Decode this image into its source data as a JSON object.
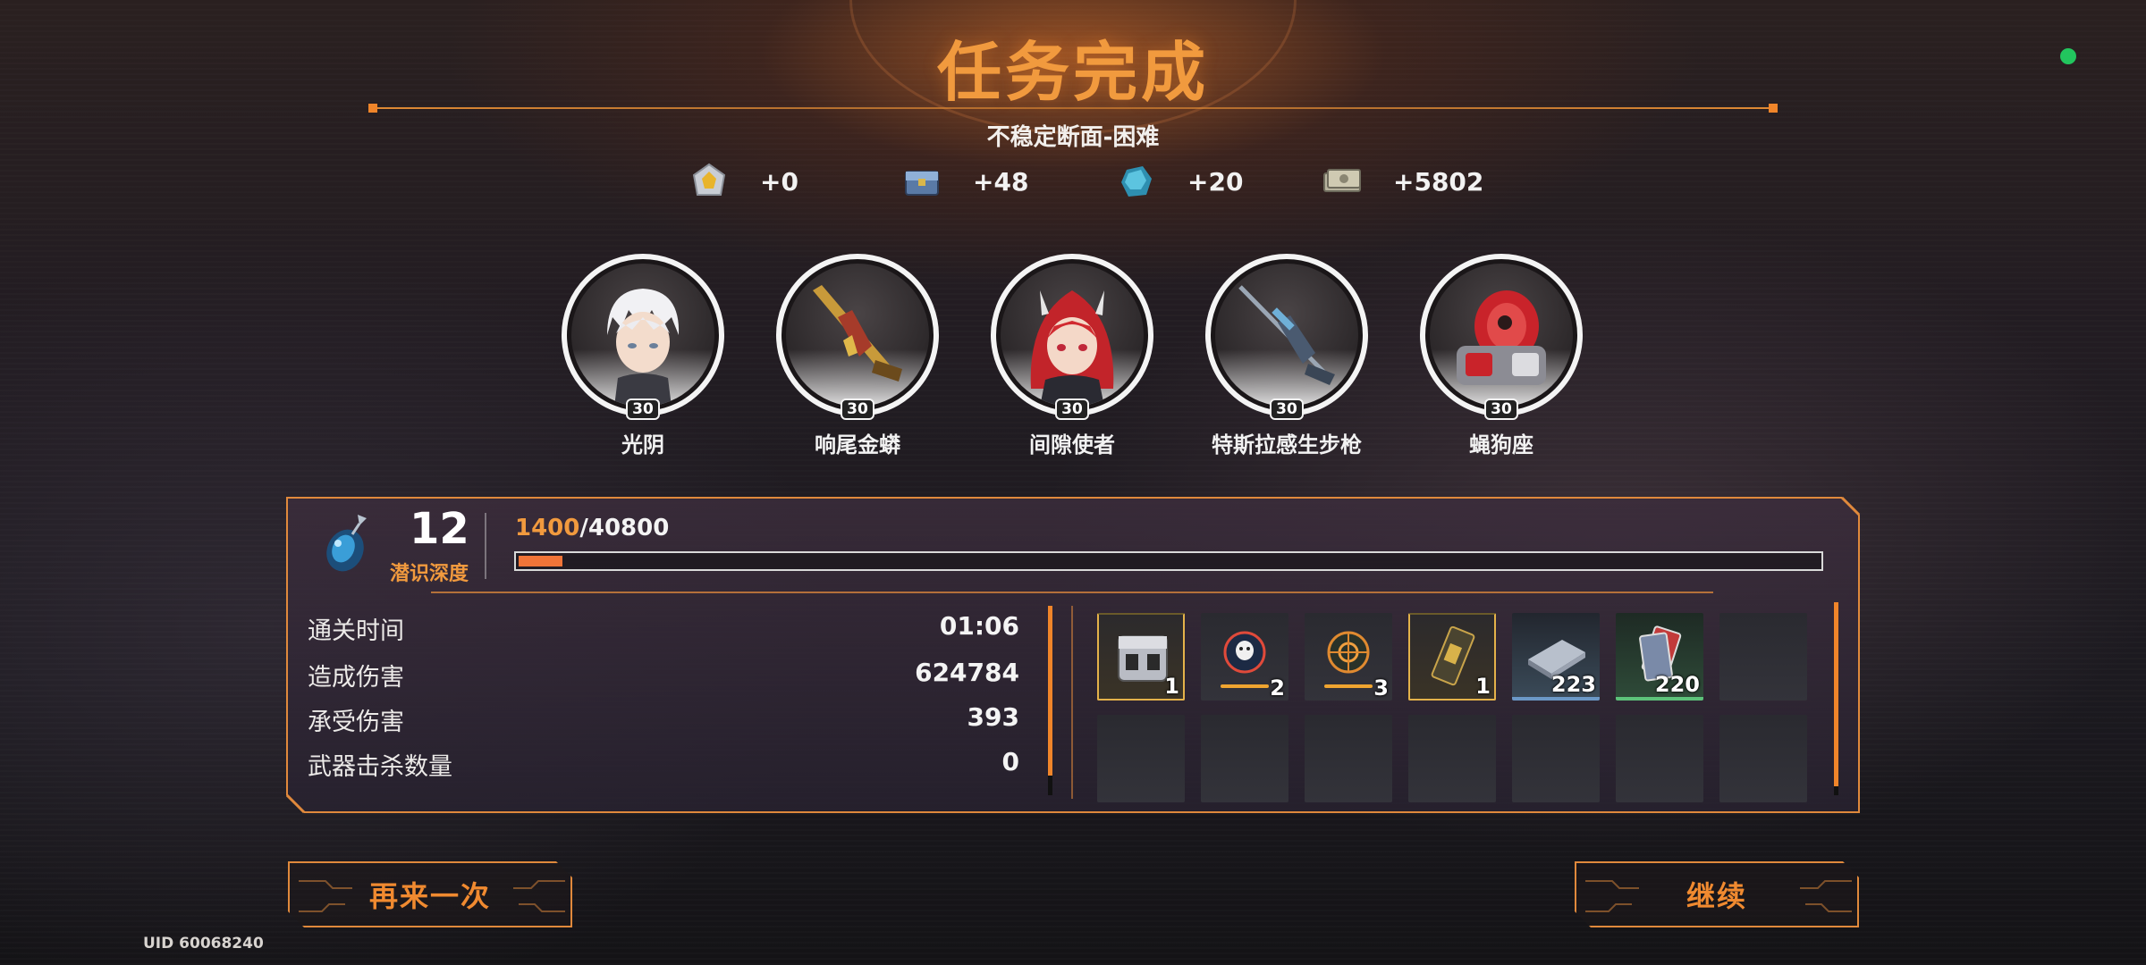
{
  "header": {
    "title": "任务完成",
    "subtitle": "不稳定断面-困难"
  },
  "rewards": [
    {
      "icon": "yellow-crystal-icon",
      "value": "+0"
    },
    {
      "icon": "blue-chest-icon",
      "value": "+48"
    },
    {
      "icon": "blue-ore-icon",
      "value": "+20"
    },
    {
      "icon": "banknote-icon",
      "value": "+5802"
    }
  ],
  "characters": [
    {
      "name": "光阴",
      "level": "30",
      "icon": "white-hair-character-avatar"
    },
    {
      "name": "响尾金蟒",
      "level": "30",
      "icon": "golden-rifle-icon"
    },
    {
      "name": "间隙使者",
      "level": "30",
      "icon": "red-hair-character-avatar"
    },
    {
      "name": "特斯拉感生步枪",
      "level": "30",
      "icon": "sniper-rifle-icon"
    },
    {
      "name": "蝇狗座",
      "level": "30",
      "icon": "red-mech-companion-icon"
    }
  ],
  "depth": {
    "level": "12",
    "label": "潜识深度",
    "exp_current": "1400",
    "exp_sep": "/",
    "exp_max": "40800",
    "progress": 0.034,
    "icon": "crystal-pendant-icon"
  },
  "stats": [
    {
      "label": "通关时间",
      "value": "01:06"
    },
    {
      "label": "造成伤害",
      "value": "624784"
    },
    {
      "label": "承受伤害",
      "value": "393"
    },
    {
      "label": "武器击杀数量",
      "value": "0"
    }
  ],
  "loot": [
    {
      "icon": "supply-crate-icon",
      "qty": "1",
      "rarity": "gold"
    },
    {
      "icon": "mask-badge-icon",
      "qty": "2",
      "rarity": "plain"
    },
    {
      "icon": "target-badge-icon",
      "qty": "3",
      "rarity": "plain"
    },
    {
      "icon": "ammo-card-icon",
      "qty": "1",
      "rarity": "gold"
    },
    {
      "icon": "metal-plate-icon",
      "qty": "223",
      "rarity": "blue"
    },
    {
      "icon": "card-pack-icon",
      "qty": "220",
      "rarity": "green"
    }
  ],
  "buttons": {
    "retry": "再来一次",
    "continue": "继续"
  },
  "footer": {
    "uid": "UID 60068240"
  },
  "colors": {
    "accent": "#f19a3e",
    "status_online": "#22c55e"
  }
}
